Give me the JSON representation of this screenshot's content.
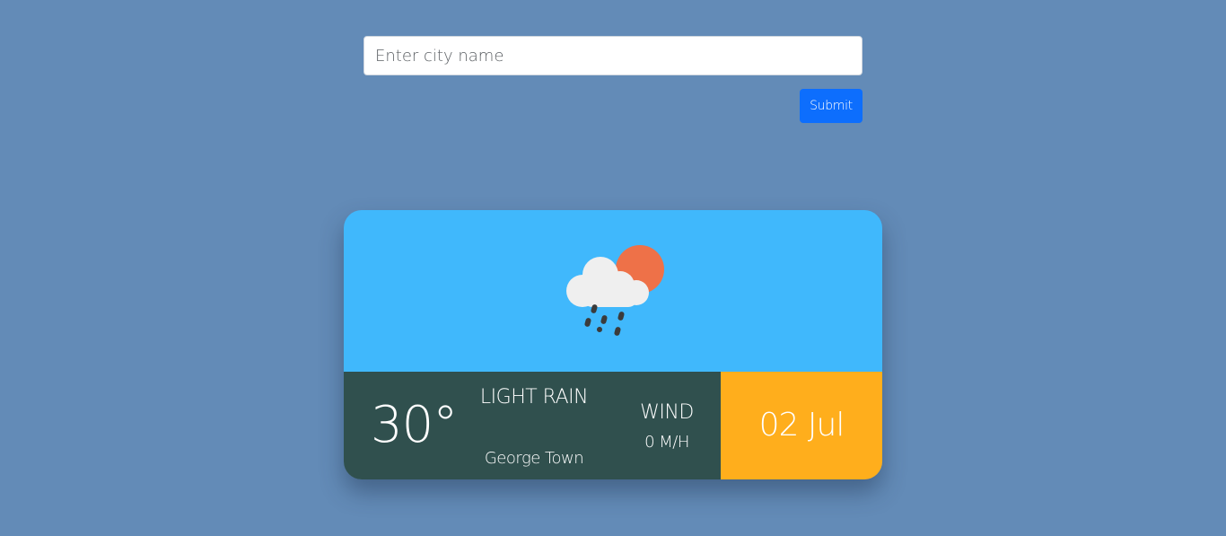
{
  "search": {
    "placeholder": "Enter city name",
    "value": "",
    "submit_label": "Submit"
  },
  "weather": {
    "icon": "cloud-sun-rain-icon",
    "temperature": "30°",
    "condition": "LIGHT RAIN",
    "city": "George Town",
    "wind_label": "WIND",
    "wind_value": "0 M/H",
    "date": "02 Jul"
  },
  "colors": {
    "page_background": "#638bb7",
    "card_top": "#40b8fc",
    "card_bottom": "#30504e",
    "date_panel": "#ffae1c",
    "submit_button": "#0d6efd",
    "sun": "#ee7148",
    "cloud": "#efefef",
    "rain": "#3b3b3b"
  }
}
